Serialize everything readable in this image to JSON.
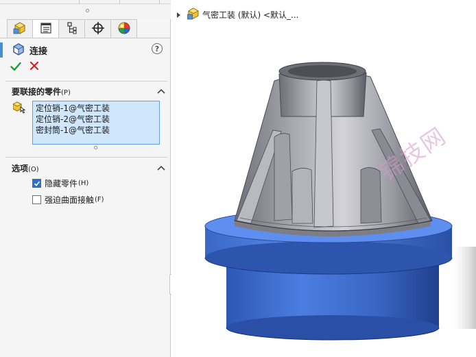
{
  "panel": {
    "tabs": [
      {
        "name": "feature-manager-tab",
        "icon": "feature-tree-icon"
      },
      {
        "name": "property-manager-tab",
        "icon": "property-list-icon"
      },
      {
        "name": "configuration-manager-tab",
        "icon": "configuration-icon"
      },
      {
        "name": "dimxpert-tab",
        "icon": "crosshair-icon"
      },
      {
        "name": "display-manager-tab",
        "icon": "appearance-sphere-icon"
      }
    ],
    "active_tab": 1,
    "title": "连接",
    "help": "?",
    "components_section": {
      "title": "要联接的零件",
      "shortcut": "(P)",
      "items": [
        "定位销-1@气密工装",
        "定位销-2@气密工装",
        "密封筒-1@气密工装"
      ]
    },
    "options_section": {
      "title": "选项",
      "shortcut": "(O)",
      "options": [
        {
          "label": "隐藏零件",
          "shortcut": "(H)",
          "checked": true
        },
        {
          "label": "强迫曲面接触",
          "shortcut": "(F)",
          "checked": false
        }
      ]
    }
  },
  "viewport": {
    "tree_label": "气密工装 (默认) <默认_...",
    "watermark": "锦技网"
  },
  "colors": {
    "accent": "#4a8fd4",
    "selection_fill": "#cfe6fb",
    "ok_green": "#1f9a3a",
    "cancel_red": "#d42020",
    "flange_blue": "#3f6fd0",
    "body_gray": "#8c8c94"
  }
}
